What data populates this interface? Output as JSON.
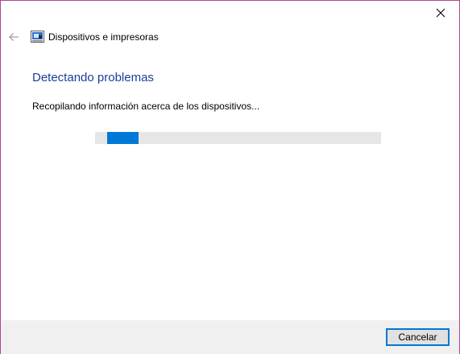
{
  "window": {
    "title": "Dispositivos e impresoras",
    "close_icon": "close-icon",
    "back_icon": "back-arrow-icon",
    "app_icon": "devices-printers-icon"
  },
  "main": {
    "heading": "Detectando problemas",
    "status": "Recopilando información acerca de los dispositivos...",
    "progress": "indeterminate"
  },
  "footer": {
    "cancel_label": "Cancelar"
  },
  "colors": {
    "accent": "#0078d7",
    "heading": "#1a3e9a",
    "footer_bg": "#f0f0f0",
    "progress_track": "#e6e6e6"
  }
}
